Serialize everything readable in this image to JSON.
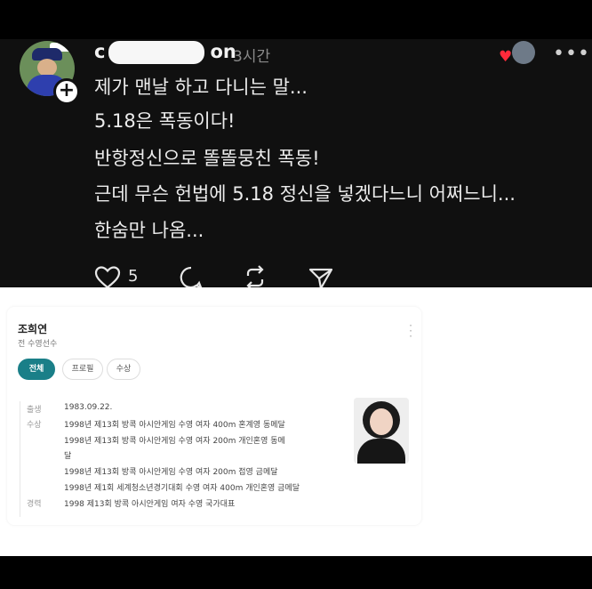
{
  "post": {
    "username_start": "c",
    "username_end": "on",
    "time": "3시간",
    "lines": [
      "제가 맨날 하고 다니는 말...",
      "5.18은 폭동이다!",
      "반항정신으로 똘똘뭉친 폭동!",
      "근데 무슨 헌법에 5.18 정신을 넣겠다느니 어쩌느니...",
      "한숨만 나옴..."
    ],
    "like_count": "5",
    "icons": [
      "heart-icon",
      "comment-icon",
      "repost-icon",
      "send-icon",
      "more-icon"
    ]
  },
  "profile": {
    "name": "조희연",
    "role": "전 수영선수",
    "tabs": [
      "전체",
      "프로필",
      "수상"
    ],
    "birth_label": "출생",
    "birth": "1983.09.22.",
    "awards_label": "수상",
    "awards": [
      "1998년 제13회 방콕 아시안게임 수영 여자 400m 혼계영 동메달",
      "1998년 제13회 방콕 아시안게임 수영 여자 200m 개인혼영 동메",
      "달",
      "1998년 제13회 방콕 아시안게임 수영 여자 200m 접영 금메달",
      "1998년 제1회 세계청소년경기대회 수영 여자 400m 개인혼영 금메달"
    ],
    "career_label": "경력",
    "career": "1998 제13회 방콕 아시안게임 여자 수영 국가대표"
  },
  "colors": {
    "post_bg": "#101010",
    "accent": "#1a7f88",
    "like_red": "#ff2a3a"
  }
}
